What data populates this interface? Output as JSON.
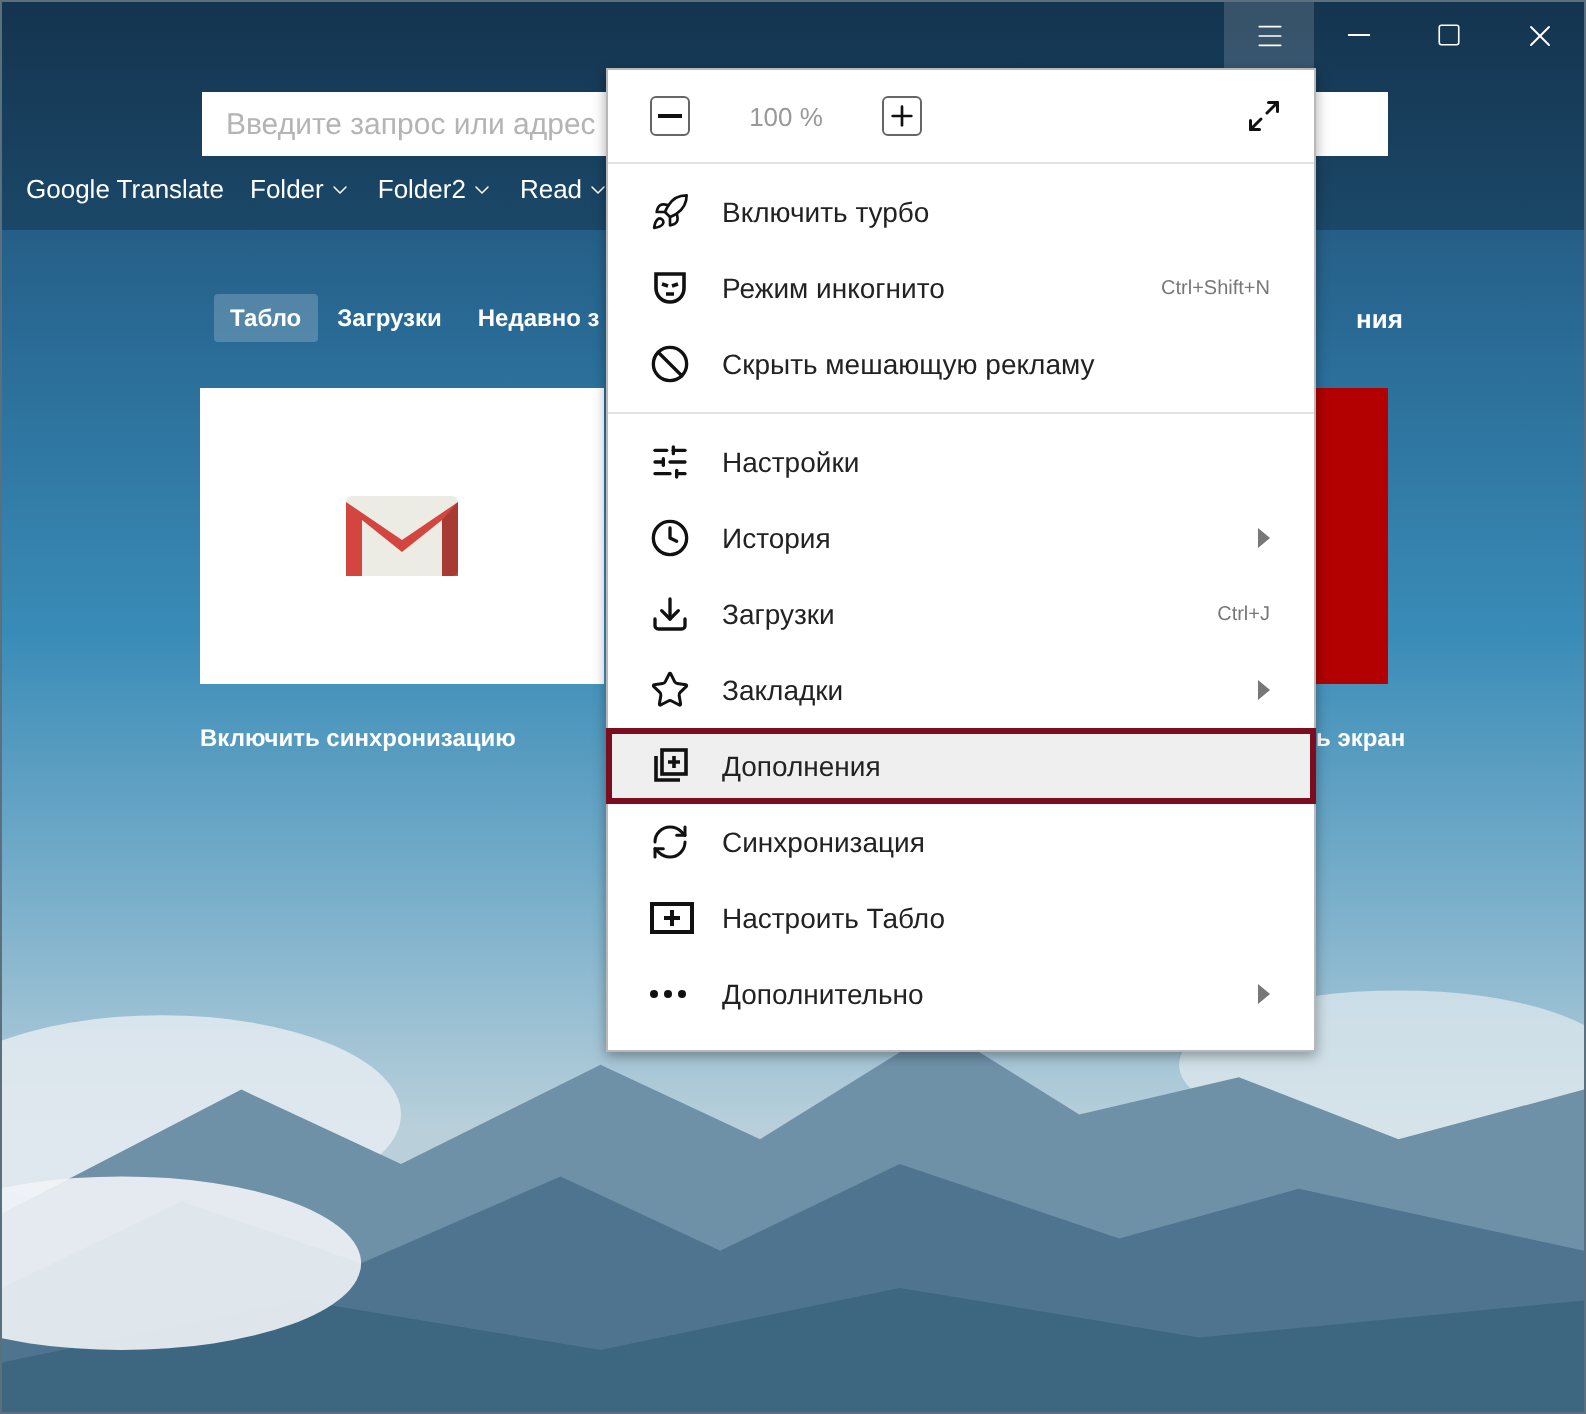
{
  "title_bar": {
    "menu_button": {
      "active": true
    }
  },
  "search": {
    "placeholder": "Введите запрос или адрес"
  },
  "bookmarks": [
    {
      "label": "Google Translate",
      "folder": false
    },
    {
      "label": "Folder",
      "folder": true
    },
    {
      "label": "Folder2",
      "folder": true
    },
    {
      "label": "Read",
      "folder": true
    }
  ],
  "tabs": [
    {
      "label": "Табло",
      "selected": true
    },
    {
      "label": "Загрузки",
      "selected": false
    },
    {
      "label": "Недавно з",
      "selected": false
    }
  ],
  "tab_right_fragment": "ния",
  "tiles": [
    {
      "kind": "mail",
      "caption": "Включить синхронизацию"
    },
    {
      "kind": "color",
      "color": "#b30000",
      "caption": "ь экран"
    }
  ],
  "menu": {
    "zoom": {
      "value": "100 %"
    },
    "groups": [
      [
        {
          "label": "Включить турбо",
          "selected": false,
          "submenu": false
        },
        {
          "label": "Режим инкогнито",
          "shortcut": "Ctrl+Shift+N",
          "selected": false,
          "submenu": false
        },
        {
          "label": "Скрыть мешающую рекламу",
          "selected": false,
          "submenu": false
        }
      ],
      [
        {
          "label": "Настройки",
          "selected": false,
          "submenu": false
        },
        {
          "label": "История",
          "selected": false,
          "submenu": true
        },
        {
          "label": "Загрузки",
          "shortcut": "Ctrl+J",
          "selected": false,
          "submenu": false
        },
        {
          "label": "Закладки",
          "selected": false,
          "submenu": true
        },
        {
          "label": "Дополнения",
          "selected": true,
          "submenu": false
        },
        {
          "label": "Синхронизация",
          "selected": false,
          "submenu": false
        },
        {
          "label": "Настроить Табло",
          "selected": false,
          "submenu": false
        },
        {
          "label": "Дополнительно",
          "selected": false,
          "submenu": true
        }
      ]
    ]
  }
}
